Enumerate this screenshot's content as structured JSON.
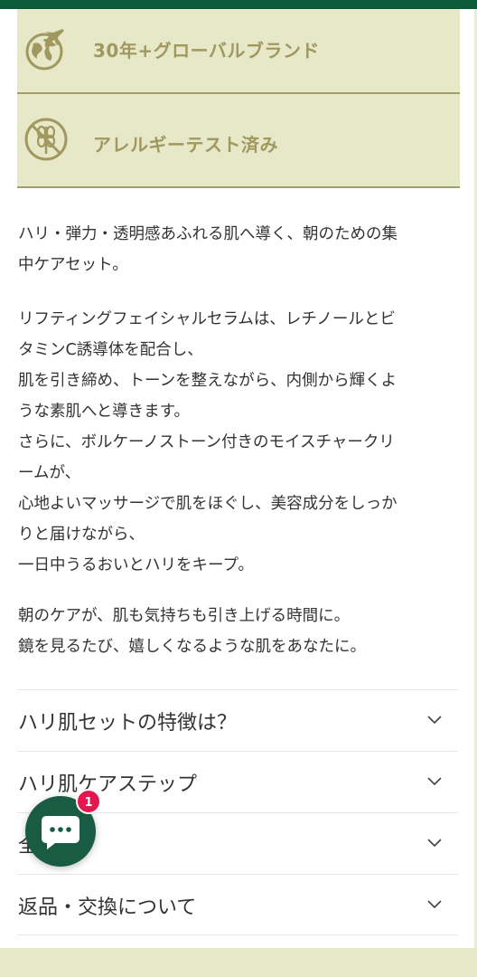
{
  "badges": [
    {
      "label": "30年+グローバルブランド",
      "icon": "globe-plane-icon"
    },
    {
      "label": "アレルギーテスト済み",
      "icon": "no-allergen-icon"
    }
  ],
  "description": {
    "p1": [
      "ハリ・弾力・透明感あふれる肌へ導く、朝のための集",
      "中ケアセット。"
    ],
    "p2": [
      "リフティングフェイシャルセラムは、レチノールとビ",
      "タミンC誘導体を配合し、",
      "肌を引き締め、トーンを整えながら、内側から輝くよ",
      "うな素肌へと導きます。",
      "さらに、ボルケーノストーン付きのモイスチャークリ",
      "ームが、",
      "心地よいマッサージで肌をほぐし、美容成分をしっか",
      "りと届けながら、",
      "一日中うるおいとハリをキープ。"
    ],
    "p3": [
      "朝のケアが、肌も気持ちも引き上げる時間に。",
      "鏡を見るたび、嬉しくなるような肌をあなたに。"
    ]
  },
  "accordion": [
    {
      "label": "ハリ肌セットの特徴は？"
    },
    {
      "label": "ハリ肌ケアステップ"
    },
    {
      "label": "全"
    },
    {
      "label": "返品・交換について"
    }
  ],
  "chat": {
    "badge_count": "1",
    "icon": "chat-bubble-icon"
  },
  "colors": {
    "brand_green": "#0b5a3a",
    "badge_bg": "#e6e8c8",
    "badge_text": "#a0985f",
    "notification": "#e4184f"
  }
}
